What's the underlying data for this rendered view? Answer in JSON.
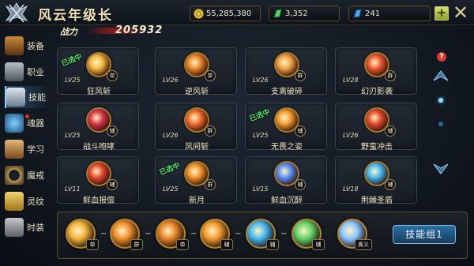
{
  "window": {
    "title": "风云年级长"
  },
  "resources": [
    {
      "icon": "coin-icon",
      "value": "55,285,380"
    },
    {
      "icon": "green-gem-icon",
      "value": "3,352"
    },
    {
      "icon": "blue-gem-icon",
      "value": "241"
    }
  ],
  "power": {
    "label": "战力",
    "value": "205932"
  },
  "sidebar": [
    {
      "label": "装备",
      "active": false,
      "dot": false
    },
    {
      "label": "职业",
      "active": false,
      "dot": false
    },
    {
      "label": "技能",
      "active": true,
      "dot": false
    },
    {
      "label": "魂器",
      "active": false,
      "dot": true
    },
    {
      "label": "学习",
      "active": false,
      "dot": false
    },
    {
      "label": "魔戒",
      "active": false,
      "dot": false
    },
    {
      "label": "灵纹",
      "active": false,
      "dot": false
    },
    {
      "label": "时装",
      "active": false,
      "dot": false
    }
  ],
  "skills": [
    {
      "name": "狂风斩",
      "level": "LV25",
      "tag": "单",
      "selected": true,
      "selected_label": "已选中",
      "color": "#f2b43c"
    },
    {
      "name": "逆风斩",
      "level": "LV26",
      "tag": "单",
      "selected": false,
      "color": "#e8842a"
    },
    {
      "name": "支离破碎",
      "level": "LV26",
      "tag": "群",
      "selected": false,
      "color": "#f0a044"
    },
    {
      "name": "幻刃影袭",
      "level": "LV28",
      "tag": "群",
      "selected": false,
      "color": "#e9572f"
    },
    {
      "name": "战斗咆哮",
      "level": "LV25",
      "tag": "辅",
      "selected": false,
      "color": "#d8354a"
    },
    {
      "name": "风间斩",
      "level": "LV26",
      "tag": "群",
      "selected": false,
      "color": "#f06a2c"
    },
    {
      "name": "无畏之姿",
      "level": "LV25",
      "tag": "辅",
      "selected": true,
      "selected_label": "已选中",
      "color": "#f39b2f"
    },
    {
      "name": "野蛮冲击",
      "level": "LV26",
      "tag": "辅",
      "selected": false,
      "color": "#df4a2a"
    },
    {
      "name": "鲜血报偿",
      "level": "LV11",
      "tag": "辅",
      "selected": false,
      "color": "#e2452c"
    },
    {
      "name": "新月",
      "level": "LV25",
      "tag": "群",
      "selected": true,
      "selected_label": "已选中",
      "color": "#f0902c"
    },
    {
      "name": "鲜血沉醉",
      "level": "LV15",
      "tag": "辅",
      "selected": false,
      "color": "#5a8df0"
    },
    {
      "name": "荆棘圣盾",
      "level": "LV18",
      "tag": "辅",
      "selected": false,
      "color": "#44b8f0"
    }
  ],
  "skill_bar": [
    {
      "tag": "单",
      "color": "#f2b43c"
    },
    {
      "tag": "群",
      "color": "#f0902c"
    },
    {
      "tag": "单",
      "color": "#e8842a"
    },
    {
      "tag": "辅",
      "color": "#f39b2f"
    },
    {
      "tag": "辅",
      "color": "#44b8f0"
    },
    {
      "tag": "辅",
      "color": "#63d36a"
    },
    {
      "tag": "奥义",
      "color": "#8cc8ff"
    }
  ],
  "skill_group_label": "技能组1",
  "links": [
    "~",
    "~",
    "~",
    "~",
    "~"
  ]
}
